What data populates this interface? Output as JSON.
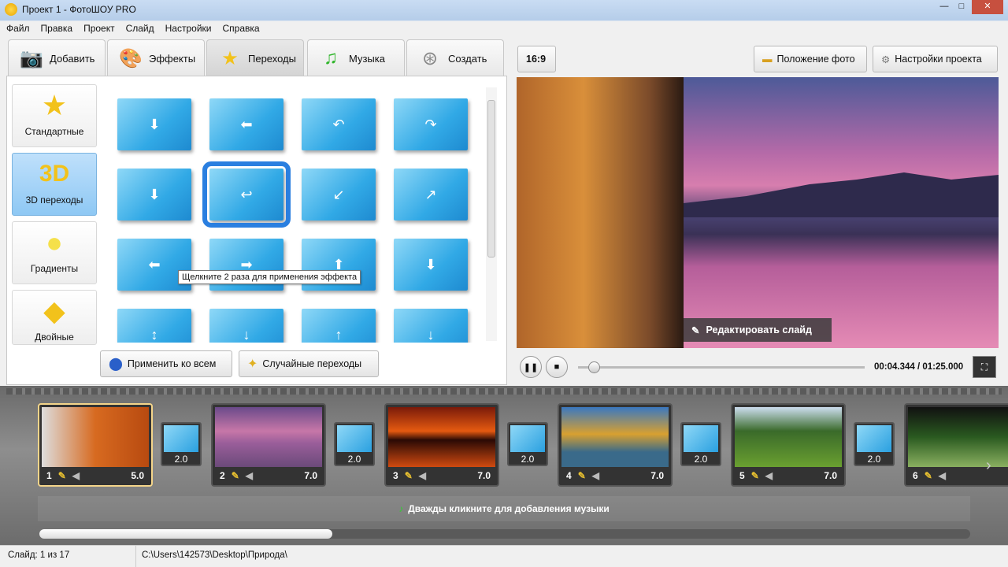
{
  "window": {
    "title": "Проект 1 - ФотоШОУ PRO",
    "min": "—",
    "max": "□",
    "close": "✕"
  },
  "menu": [
    "Файл",
    "Правка",
    "Проект",
    "Слайд",
    "Настройки",
    "Справка"
  ],
  "tabs": [
    {
      "label": "Добавить",
      "icon": "camera-icon"
    },
    {
      "label": "Эффекты",
      "icon": "palette-icon"
    },
    {
      "label": "Переходы",
      "icon": "star-icon"
    },
    {
      "label": "Музыка",
      "icon": "music-note-icon"
    },
    {
      "label": "Создать",
      "icon": "film-reel-icon"
    }
  ],
  "categories": [
    {
      "label": "Стандартные",
      "glyph": "★"
    },
    {
      "label": "3D переходы",
      "glyph": "3D"
    },
    {
      "label": "Градиенты",
      "glyph": "●"
    },
    {
      "label": "Двойные",
      "glyph": "◆"
    }
  ],
  "transition_arrows": [
    "⬇",
    "⬅",
    "↶",
    "↷",
    "⬇",
    "↩",
    "↙",
    "↗",
    "⬅",
    "➡",
    "⬆",
    "⬇",
    "↕",
    "↓",
    "↑",
    "↓"
  ],
  "tooltip": "Щелкните 2 раза для применения эффекта",
  "buttons": {
    "apply_all": "Применить ко всем",
    "random": "Случайные переходы",
    "aspect": "16:9",
    "photo_position": "Положение фото",
    "project_settings": "Настройки проекта",
    "edit_slide": "Редактировать слайд"
  },
  "player": {
    "time": "00:04.344 / 01:25.000",
    "progress": 0.055
  },
  "slides": [
    {
      "n": "1",
      "dur": "5.0"
    },
    {
      "n": "2",
      "dur": "7.0"
    },
    {
      "n": "3",
      "dur": "7.0"
    },
    {
      "n": "4",
      "dur": "7.0"
    },
    {
      "n": "5",
      "dur": "7.0"
    },
    {
      "n": "6",
      "dur": ""
    }
  ],
  "transitions": [
    "2.0",
    "2.0",
    "2.0",
    "2.0",
    "2.0"
  ],
  "music_hint": "Дважды кликните для добавления музыки",
  "status": {
    "slide": "Слайд: 1 из 17",
    "path": "C:\\Users\\142573\\Desktop\\Природа\\"
  }
}
